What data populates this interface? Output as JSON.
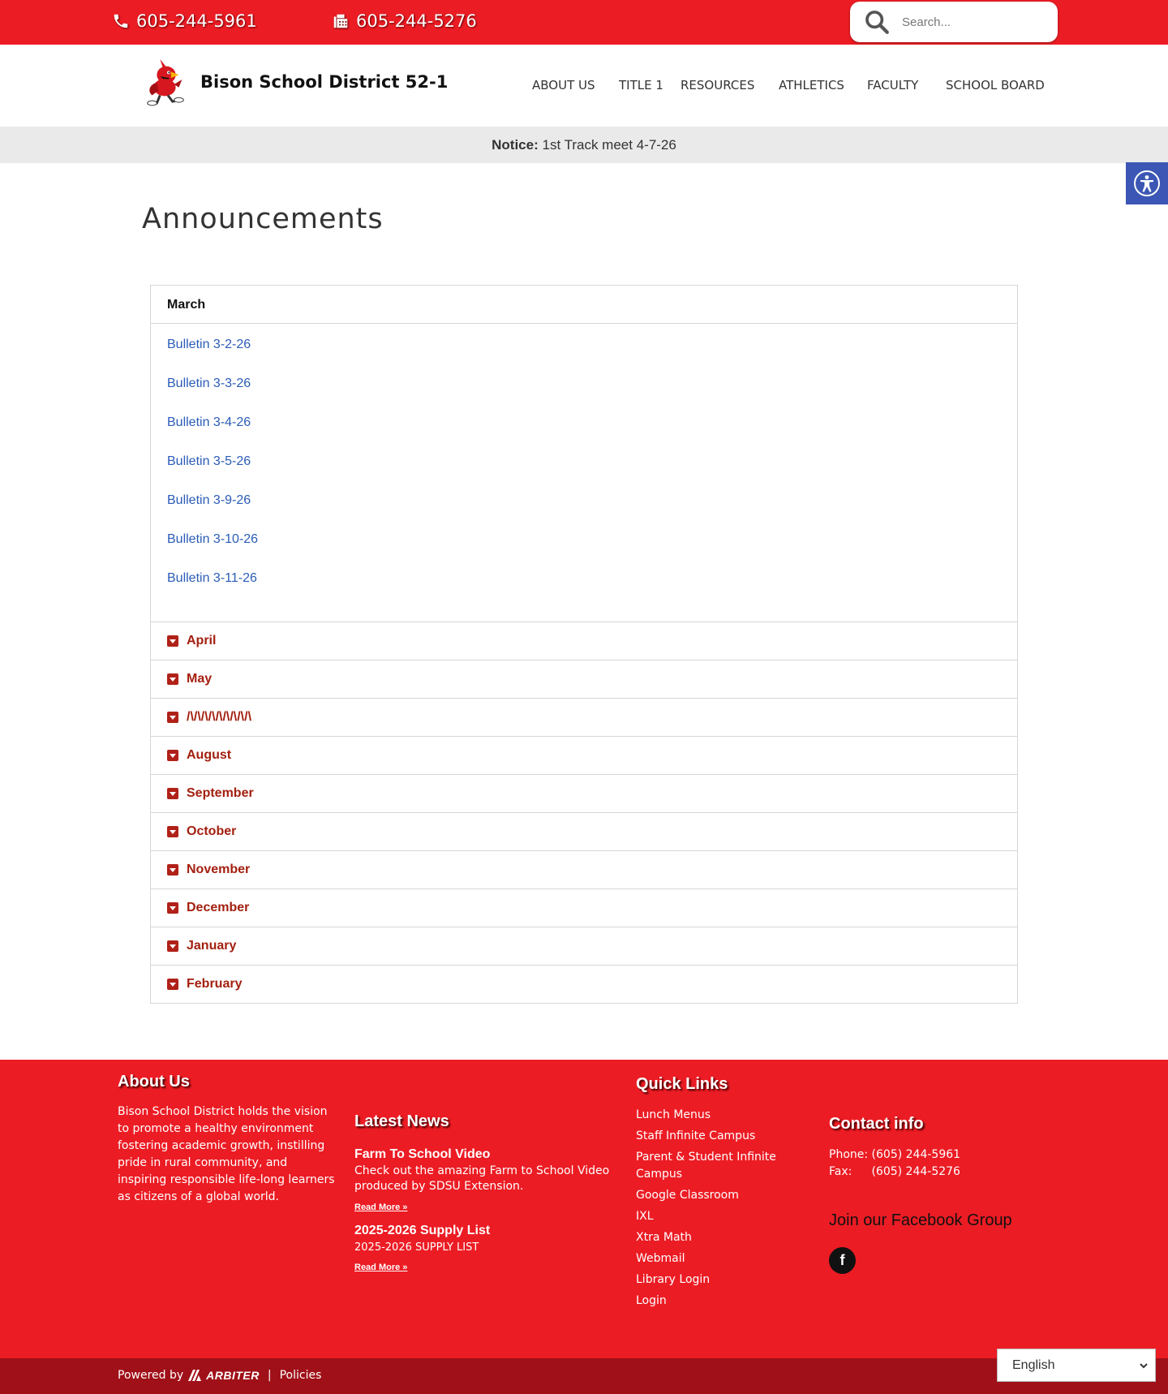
{
  "topbar": {
    "phone": "605-244-5961",
    "fax": "605-244-5276",
    "search_placeholder": "Search..."
  },
  "header": {
    "site_title": "Bison School District 52-1",
    "nav": [
      "ABOUT US",
      "TITLE 1",
      "RESOURCES",
      "ATHLETICS",
      "FACULTY",
      "SCHOOL BOARD"
    ]
  },
  "notice": {
    "label": "Notice:",
    "text": "1st Track meet 4-7-26"
  },
  "page_title": "Announcements",
  "accordion": {
    "open_section": "March",
    "open_items": [
      "Bulletin 3-2-26",
      "Bulletin 3-3-26",
      "Bulletin 3-4-26",
      "Bulletin 3-5-26",
      "Bulletin 3-9-26",
      "Bulletin 3-10-26",
      "Bulletin 3-11-26"
    ],
    "collapsed_sections": [
      "April",
      "May",
      "/\\/\\/\\/\\/\\/\\/\\/\\/\\",
      "August",
      "September",
      "October",
      "November",
      "December",
      "January",
      "February"
    ]
  },
  "footer": {
    "about_heading": "About Us",
    "about_text": "Bison School District holds the vision to promote a healthy environment fostering academic growth, instilling pride in rural community, and inspiring responsible life-long learners as citizens of a global world.",
    "news_heading": "Latest News",
    "news": [
      {
        "title": "Farm To School Video",
        "excerpt": "Check out the amazing Farm to School Video produced by  SDSU Extension.",
        "more": "Read More »"
      },
      {
        "title": "2025-2026 Supply List",
        "excerpt": "2025-2026 SUPPLY LIST",
        "more": "Read More »"
      }
    ],
    "quick_heading": "Quick Links",
    "quick_links": [
      "Lunch Menus",
      "Staff Infinite Campus",
      "Parent & Student Infinite Campus",
      "Google Classroom",
      "IXL",
      "Xtra Math",
      "Webmail",
      "Library Login",
      "Login"
    ],
    "contact_heading": "Contact info",
    "contact_phone_label": "Phone:",
    "contact_phone": "(605) 244-5961",
    "contact_fax_label": "Fax:",
    "contact_fax": "(605) 244-5276",
    "facebook_text": "Join our Facebook Group",
    "facebook_icon": "f"
  },
  "bottombar": {
    "powered_by": "Powered by",
    "brand": "ARBITER",
    "separator": "|",
    "policies": "Policies"
  },
  "language": {
    "selected": "English"
  },
  "colors": {
    "brand_red": "#ec1c24",
    "dark_red": "#a01018",
    "accordion_label": "#a31f0f",
    "link_blue": "#2a5cb8",
    "accessibility_blue": "#3b56b4"
  }
}
